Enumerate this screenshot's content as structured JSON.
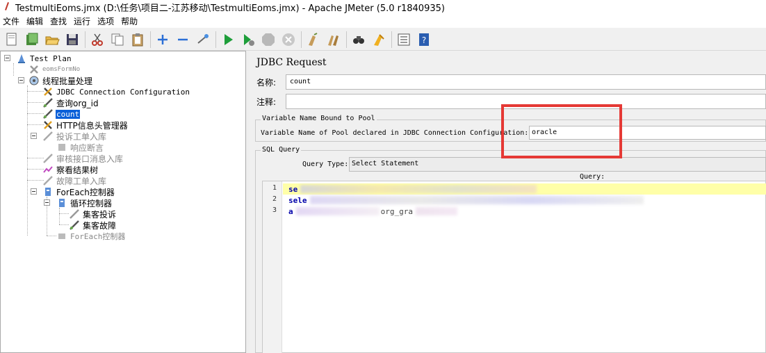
{
  "window": {
    "title": "TestmultiEoms.jmx (D:\\任务\\项目二-江苏移动\\TestmultiEoms.jmx) - Apache JMeter (5.0 r1840935)"
  },
  "menu": [
    "文件",
    "编辑",
    "查找",
    "运行",
    "选项",
    "帮助"
  ],
  "toolbar": {
    "icons": [
      "new-icon",
      "templates-icon",
      "open-icon",
      "save-icon",
      "cut-icon",
      "copy-icon",
      "paste-icon",
      "expand-icon",
      "collapse-icon",
      "toggle-icon",
      "start-icon",
      "start-no-pause-icon",
      "stop-icon",
      "shutdown-icon",
      "clear-icon",
      "clear-all-icon",
      "search-icon",
      "reset-search-icon",
      "function-helper-icon",
      "help-icon"
    ]
  },
  "tree": {
    "items": [
      {
        "label": "Test Plan",
        "icon": "test-plan-icon"
      },
      {
        "label": "eomsFormNo",
        "icon": "config-icon",
        "disabled": true
      },
      {
        "label": "线程批量处理",
        "icon": "thread-group-icon"
      },
      {
        "label": "JDBC Connection Configuration",
        "icon": "config-icon"
      },
      {
        "label": "查询org_id",
        "icon": "sampler-icon"
      },
      {
        "label": "count",
        "icon": "sampler-icon",
        "selected": true
      },
      {
        "label": "HTTP信息头管理器",
        "icon": "config-icon"
      },
      {
        "label": "投诉工单入库",
        "icon": "sampler-icon",
        "disabled": true
      },
      {
        "label": "响应断言",
        "icon": "assertion-icon",
        "disabled": true
      },
      {
        "label": "审核接口消息入库",
        "icon": "sampler-icon",
        "disabled": true
      },
      {
        "label": "察看结果树",
        "icon": "listener-icon"
      },
      {
        "label": "故障工单入库",
        "icon": "sampler-icon",
        "disabled": true
      },
      {
        "label": "ForEach控制器",
        "icon": "controller-icon"
      },
      {
        "label": "循环控制器",
        "icon": "controller-icon"
      },
      {
        "label": "集客投诉",
        "icon": "sampler-icon",
        "disabled": true
      },
      {
        "label": "集客故障",
        "icon": "sampler-icon"
      },
      {
        "label": "ForEach控制器",
        "icon": "controller-icon",
        "disabled": true
      }
    ]
  },
  "editor": {
    "title": "JDBC Request",
    "name_label": "名称:",
    "name_value": "count",
    "comment_label": "注释:",
    "comment_value": "",
    "pool_group": {
      "title": "Variable Name Bound to Pool",
      "label": "Variable Name of Pool declared in JDBC Connection Configuration:",
      "value": "oracle"
    },
    "sql_group": {
      "title": "SQL Query",
      "query_type_label": "Query Type:",
      "query_type_value": "Select Statement",
      "query_header": "Query:",
      "lines": [
        {
          "num": "1",
          "text": "se"
        },
        {
          "num": "2",
          "text": "sele"
        },
        {
          "num": "3",
          "text": "a"
        }
      ],
      "line3_fragment": "org_gra"
    }
  },
  "colors": {
    "selection": "#0a5fd8",
    "highlight_box": "#e53935",
    "current_line": "#ffffa8",
    "keyword": "#0000aa"
  }
}
